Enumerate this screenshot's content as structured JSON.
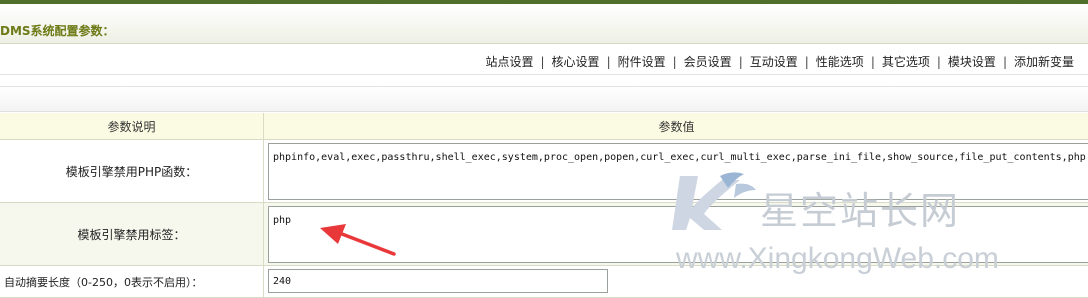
{
  "page": {
    "title": "DMS系统配置参数："
  },
  "nav": {
    "items": [
      "站点设置",
      "核心设置",
      "附件设置",
      "会员设置",
      "互动设置",
      "性能选项",
      "其它选项",
      "模块设置",
      "添加新变量"
    ],
    "separator": "|"
  },
  "table": {
    "header_label": "参数说明",
    "header_value": "参数值",
    "rows": [
      {
        "label": "模板引擎禁用PHP函数：",
        "value": "phpinfo,eval,exec,passthru,shell_exec,system,proc_open,popen,curl_exec,curl_multi_exec,parse_ini_file,show_source,file_put_contents,php"
      },
      {
        "label": "模板引擎禁用标签：",
        "value": "php"
      },
      {
        "label": "自动摘要长度（0-250，0表示不启用）：",
        "value": "240"
      }
    ]
  },
  "watermark": {
    "name": "星空站长网",
    "url": "www.XingkongWeb.com"
  },
  "colors": {
    "title": "#6d7a16",
    "header_bg": "#fbfbe4",
    "arrow": "#e8383a"
  }
}
